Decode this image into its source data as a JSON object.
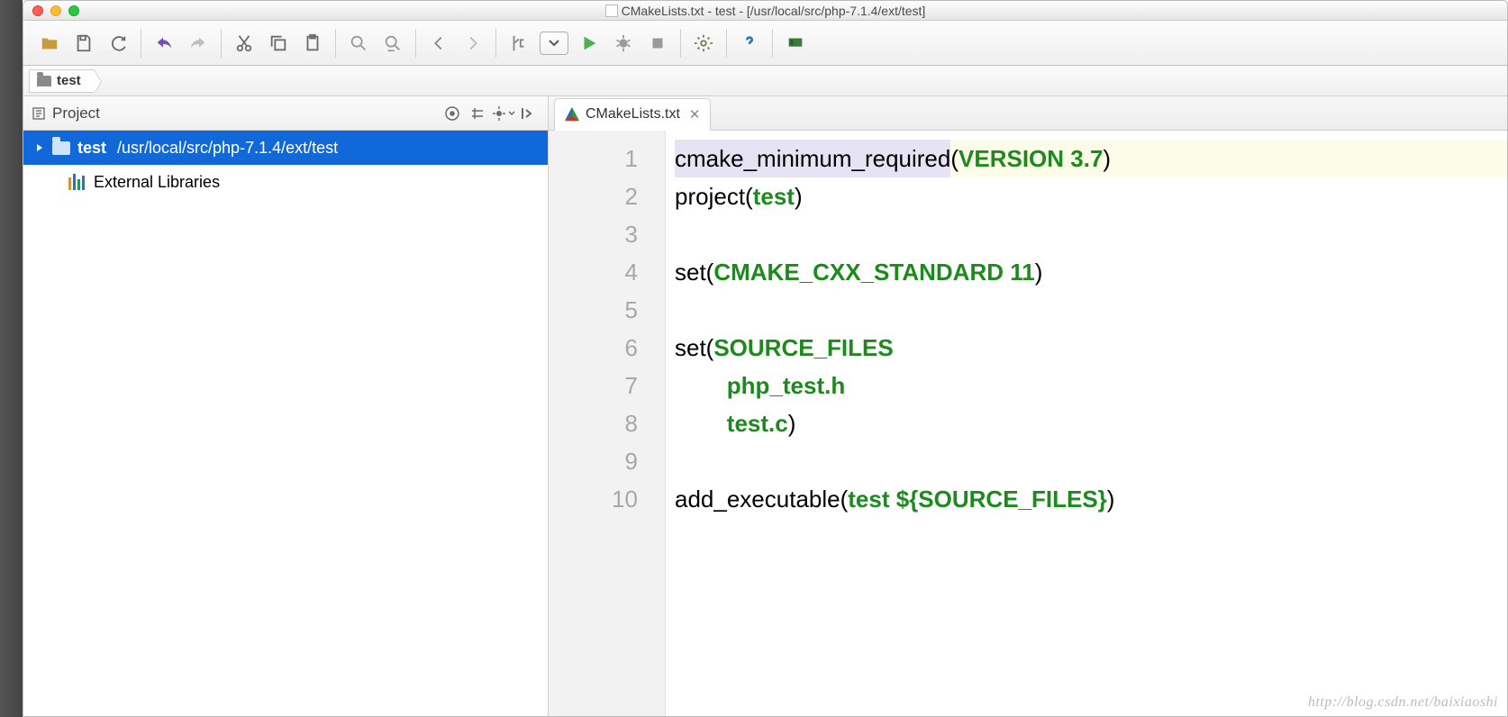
{
  "window": {
    "title": "CMakeLists.txt - test - [/usr/local/src/php-7.1.4/ext/test]"
  },
  "navbar": {
    "crumb": "test"
  },
  "projectPanel": {
    "title": "Project",
    "tree": {
      "root": {
        "name": "test",
        "path": "/usr/local/src/php-7.1.4/ext/test"
      },
      "external": "External Libraries"
    }
  },
  "editor": {
    "tabLabel": "CMakeLists.txt",
    "gutter": [
      "1",
      "2",
      "3",
      "4",
      "5",
      "6",
      "7",
      "8",
      "9",
      "10"
    ],
    "code": {
      "l1": {
        "a": "cmake_minimum_required",
        "b": "(",
        "c": "VERSION 3.7",
        "d": ")"
      },
      "l2": {
        "a": "project(",
        "b": "test",
        "c": ")"
      },
      "l4": {
        "a": "set(",
        "b": "CMAKE_CXX_STANDARD 11",
        "c": ")"
      },
      "l6": {
        "a": "set(",
        "b": "SOURCE_FILES"
      },
      "l7": {
        "a": "        ",
        "b": "php_test.h"
      },
      "l8": {
        "a": "        ",
        "b": "test.c",
        "c": ")"
      },
      "l10": {
        "a": "add_executable(",
        "b": "test ${SOURCE_FILES}",
        "c": ")"
      }
    }
  },
  "watermark": "http://blog.csdn.net/baixiaoshi"
}
